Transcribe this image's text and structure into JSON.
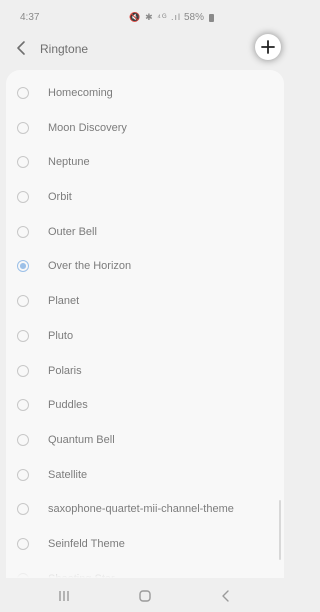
{
  "status_bar": {
    "time": "4:37",
    "icons": "🔇 ✱ ⁴ᴳ .ıl",
    "battery": "58%"
  },
  "header": {
    "title": "Ringtone"
  },
  "ringtones": [
    {
      "label": "Homecoming",
      "selected": false
    },
    {
      "label": "Moon Discovery",
      "selected": false
    },
    {
      "label": "Neptune",
      "selected": false
    },
    {
      "label": "Orbit",
      "selected": false
    },
    {
      "label": "Outer Bell",
      "selected": false
    },
    {
      "label": "Over the Horizon",
      "selected": true
    },
    {
      "label": "Planet",
      "selected": false
    },
    {
      "label": "Pluto",
      "selected": false
    },
    {
      "label": "Polaris",
      "selected": false
    },
    {
      "label": "Puddles",
      "selected": false
    },
    {
      "label": "Quantum Bell",
      "selected": false
    },
    {
      "label": "Satellite",
      "selected": false
    },
    {
      "label": "saxophone-quartet-mii-channel-theme",
      "selected": false
    },
    {
      "label": "Seinfeld Theme",
      "selected": false
    },
    {
      "label": "Shooting Star",
      "selected": false
    }
  ],
  "colors": {
    "accent": "#9cc0e8",
    "background": "#efefef",
    "card": "#f8f8f8"
  },
  "icons": {
    "back": "chevron-left-icon",
    "add": "plus-icon",
    "nav_recents": "recents-icon",
    "nav_home": "home-icon",
    "nav_back": "back-icon"
  }
}
